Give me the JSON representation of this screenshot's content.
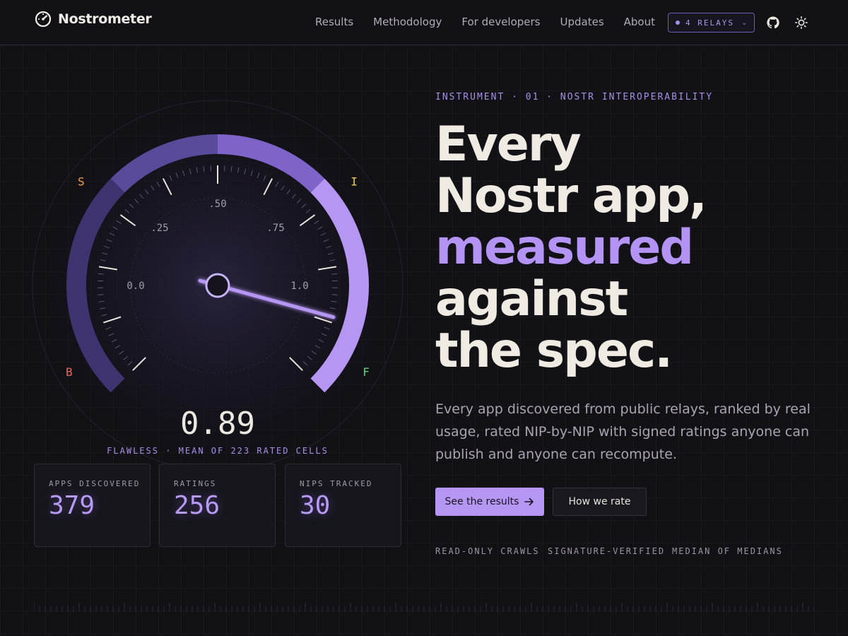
{
  "brand": {
    "name": "Nostrometer",
    "icon": "speedometer-icon"
  },
  "nav": {
    "links": [
      "Results",
      "Methodology",
      "For developers",
      "Updates",
      "About"
    ],
    "relay_pill": "4 RELAYS",
    "github_icon": "github-icon",
    "theme_icon": "sun-icon"
  },
  "gauge": {
    "value": 0.89,
    "value_text": "0.89",
    "caption": "FLAWLESS · MEAN OF 223 RATED CELLS",
    "scale_labels": [
      "0.0",
      ".25",
      ".50",
      ".75",
      "1.0"
    ],
    "grade_labels": [
      {
        "letter": "B",
        "color": "#e8665e"
      },
      {
        "letter": "S",
        "color": "#f2a14a"
      },
      {
        "letter": "I",
        "color": "#f0c94e"
      },
      {
        "letter": "F",
        "color": "#5fd17f"
      }
    ],
    "colors": {
      "band_dark": "#5a4a9a",
      "band_mid": "#7e64c8",
      "band_light": "#b596f3"
    }
  },
  "stats": [
    {
      "label": "APPS DISCOVERED",
      "value": "379"
    },
    {
      "label": "RATINGS",
      "value": "256"
    },
    {
      "label": "NIPS TRACKED",
      "value": "30"
    }
  ],
  "hero": {
    "eyebrow": "INSTRUMENT · 01 · NOSTR INTEROPERABILITY",
    "headline_1": "Every",
    "headline_2": "Nostr app,",
    "headline_accent": "measured",
    "headline_3": "against",
    "headline_4": "the spec.",
    "lede": "Every app discovered from public relays, ranked by real usage, rated NIP-by-NIP with signed ratings anyone can publish and anyone can recompute.",
    "primary_cta": "See the results",
    "primary_cta_icon": "arrow-right-icon",
    "secondary_cta": "How we rate"
  },
  "features": [
    "READ-ONLY CRAWLS",
    "SIGNATURE-VERIFIED",
    "MEDIAN OF MEDIANS"
  ],
  "colors": {
    "accent": "#b596f3",
    "background": "#121116",
    "text": "#ece8df"
  }
}
